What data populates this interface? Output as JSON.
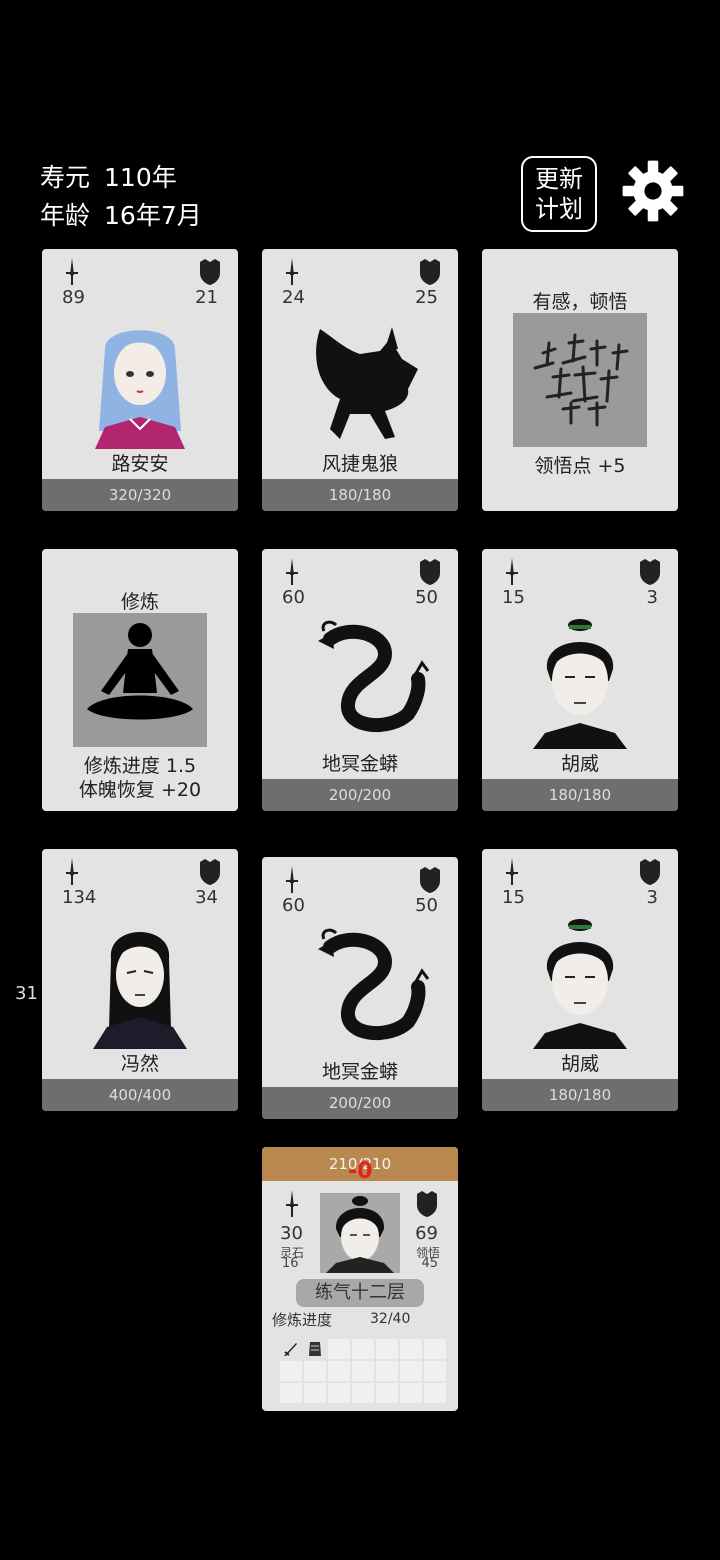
{
  "hud": {
    "lifespan_label": "寿元",
    "lifespan_value": "110年",
    "age_label": "年龄",
    "age_value": "16年7月",
    "plan_button": [
      "更新",
      "计划"
    ]
  },
  "colors": {
    "bg": "#000000",
    "card": "#e3e3e3",
    "hp_bar": "#6e6e6e",
    "player_bar": "#b8884e",
    "damage": "#e0231b"
  },
  "icons": {
    "attack": "sword-icon",
    "defense": "shield-icon",
    "settings": "gear-icon"
  },
  "cards": [
    {
      "kind": "character",
      "attack": "89",
      "defense": "21",
      "name": "路安安",
      "hp": "320/320"
    },
    {
      "kind": "monster",
      "attack": "24",
      "defense": "25",
      "name": "风捷鬼狼",
      "hp": "180/180"
    },
    {
      "kind": "event",
      "title": "有感，顿悟",
      "line1": "领悟点  +5"
    },
    {
      "kind": "event",
      "title": "修炼",
      "line1": "修炼进度  1.5",
      "line2": "体魄恢复  +20"
    },
    {
      "kind": "monster",
      "attack": "60",
      "defense": "50",
      "name": "地冥金蟒",
      "hp": "200/200"
    },
    {
      "kind": "character",
      "attack": "15",
      "defense": "3",
      "name": "胡威",
      "hp": "180/180"
    },
    {
      "kind": "character",
      "attack": "134",
      "defense": "34",
      "name": "冯然",
      "hp": "400/400"
    },
    {
      "kind": "monster",
      "attack": "60",
      "defense": "50",
      "name": "地冥金蟒",
      "hp": "200/200"
    },
    {
      "kind": "character",
      "attack": "15",
      "defense": "3",
      "name": "胡威",
      "hp": "180/180"
    }
  ],
  "side_number": "31",
  "player": {
    "hp": "210/210",
    "damage": "-0",
    "attack": "30",
    "defense": "69",
    "spirit_stone_label": "灵石",
    "spirit_stone_value": "16",
    "insight_label": "领悟",
    "insight_value": "45",
    "realm": "练气十二层",
    "progress_label": "修炼进度",
    "progress_value": "32/40"
  }
}
